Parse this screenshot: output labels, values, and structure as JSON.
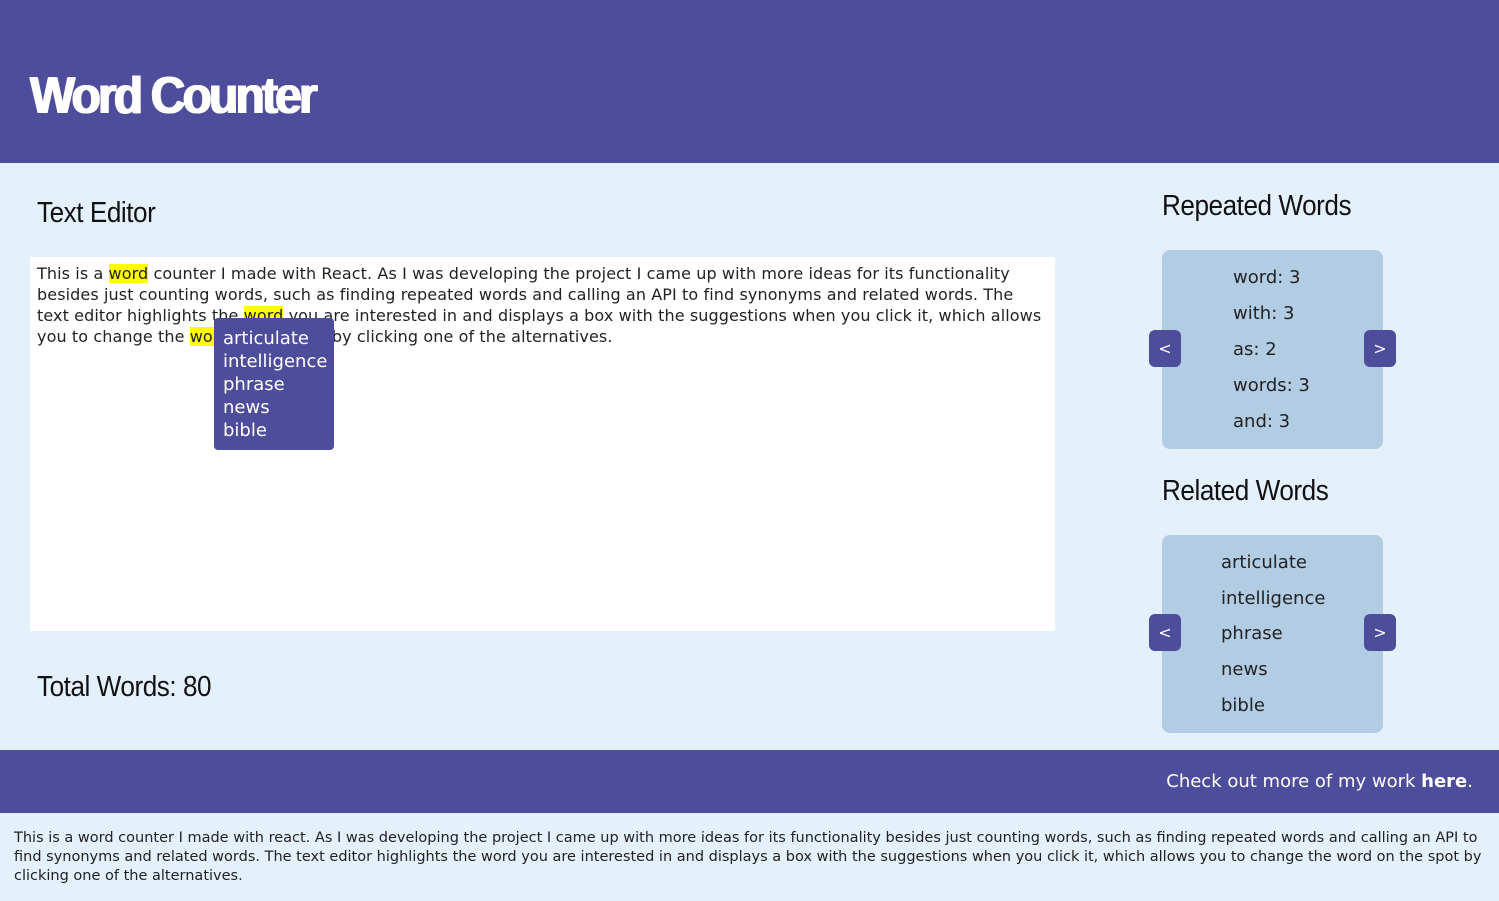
{
  "header": {
    "title": "Word Counter"
  },
  "editor": {
    "title": "Text Editor",
    "segments": [
      {
        "text": "This is a ",
        "highlight": false
      },
      {
        "text": "word",
        "highlight": true
      },
      {
        "text": " counter I made with React. As I was developing the project I came up with more ideas for its functionality besides just counting words, such as finding repeated words and calling an API to find synonyms and related words. The text editor highlights the ",
        "highlight": false
      },
      {
        "text": "word",
        "highlight": true
      },
      {
        "text": " you are interested in and displays a box with the suggestions when you click it, which allows you to change the ",
        "highlight": false
      },
      {
        "text": "word",
        "highlight": true
      },
      {
        "text": " on the spot by clicking one of the alternatives.",
        "highlight": false
      }
    ],
    "suggestions": [
      "articulate",
      "intelligence",
      "phrase",
      "news",
      "bible"
    ]
  },
  "total_words": {
    "text": "Total Words: 80",
    "count": 80
  },
  "repeated_words": {
    "title": "Repeated Words",
    "items": [
      "word: 3",
      "with: 3",
      "as: 2",
      "words: 3",
      "and: 3"
    ],
    "prev_label": "<",
    "next_label": ">"
  },
  "related_words": {
    "title": "Related Words",
    "items": [
      "articulate",
      "intelligence",
      "phrase",
      "news",
      "bible"
    ],
    "prev_label": "<",
    "next_label": ">"
  },
  "footer": {
    "prefix": "Check out more of my work ",
    "link_label": "here",
    "suffix": "."
  },
  "description": "This is a word counter I made with react. As I was developing the project I came up with more ideas for its functionality besides just counting words, such as finding repeated words and calling an API to find synonyms and related words. The text editor highlights the word you are interested in and displays a box with the suggestions when you click it, which allows you to change the word on the spot by clicking one of the alternatives.",
  "colors": {
    "primary": "#4e4d9b",
    "background": "#e4f0fc",
    "panel": "#b2cce4",
    "highlight": "#ffff00"
  }
}
